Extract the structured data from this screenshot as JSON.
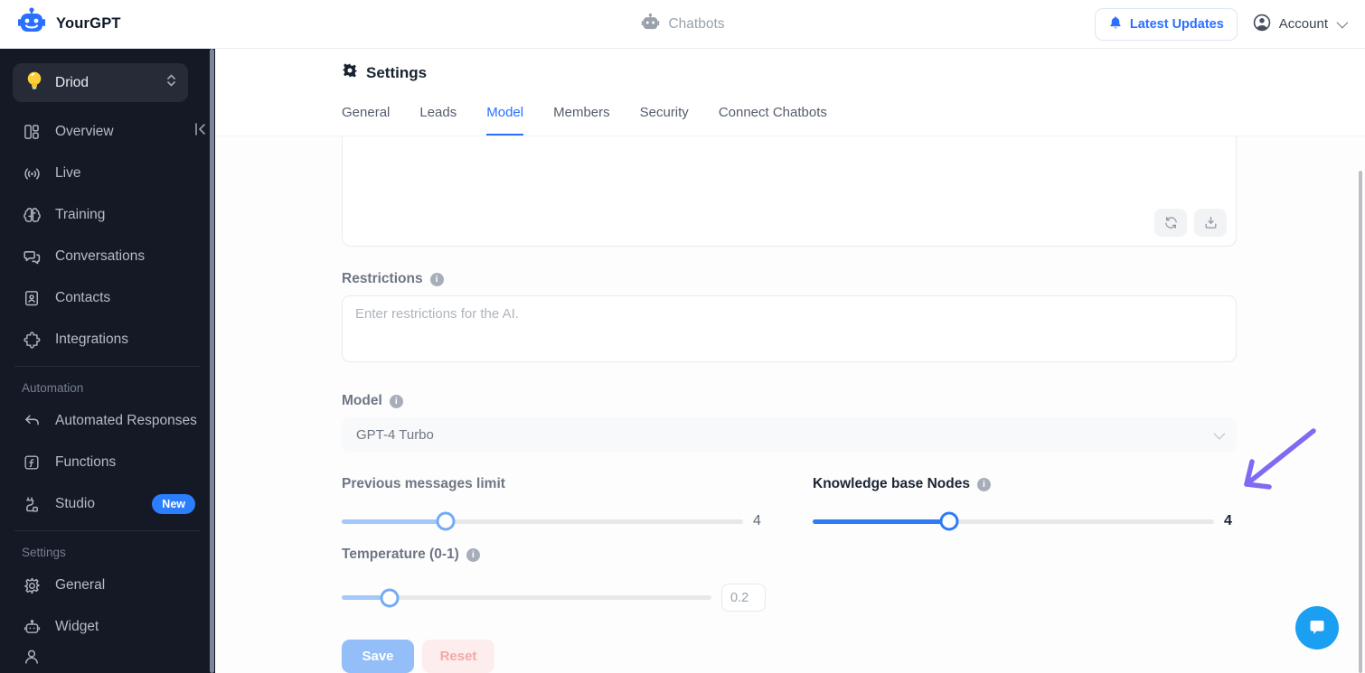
{
  "colors": {
    "accent_blue": "#2970ff",
    "slider_blue": "#2e7cf5",
    "slider_light_blue": "#a5c8fb",
    "badge_blue": "#2b7fff",
    "save_bg": "#94bef8",
    "reset_bg": "#fdeded",
    "reset_text": "#f1a9a9",
    "sidebar_bg": "#141925",
    "chat_fab": "#1b9ff2",
    "arrow_purple": "#7e6bf2"
  },
  "header": {
    "brand": "YourGPT",
    "center_title": "Chatbots",
    "latest_updates_label": "Latest Updates",
    "account_label": "Account"
  },
  "sidebar": {
    "workspace_name": "Driod",
    "items": [
      {
        "label": "Overview"
      },
      {
        "label": "Live"
      },
      {
        "label": "Training"
      },
      {
        "label": "Conversations"
      },
      {
        "label": "Contacts"
      },
      {
        "label": "Integrations"
      }
    ],
    "automation": {
      "title": "Automation",
      "items": [
        {
          "label": "Automated Responses"
        },
        {
          "label": "Functions"
        },
        {
          "label": "Studio",
          "badge": "New"
        }
      ]
    },
    "settings": {
      "title": "Settings",
      "items": [
        {
          "label": "General"
        },
        {
          "label": "Widget"
        }
      ]
    }
  },
  "main": {
    "title": "Settings",
    "tabs": [
      {
        "label": "General"
      },
      {
        "label": "Leads"
      },
      {
        "label": "Model"
      },
      {
        "label": "Members"
      },
      {
        "label": "Security"
      },
      {
        "label": "Connect Chatbots"
      }
    ],
    "restrictions": {
      "label": "Restrictions",
      "placeholder": "Enter restrictions for the AI."
    },
    "model": {
      "label": "Model",
      "value": "GPT-4 Turbo"
    },
    "prev_messages": {
      "label": "Previous messages limit",
      "value": "4"
    },
    "kb_nodes": {
      "label": "Knowledge base Nodes",
      "value": "4"
    },
    "temperature": {
      "label": "Temperature (0-1)",
      "value": "0.2"
    },
    "save_label": "Save",
    "reset_label": "Reset"
  }
}
